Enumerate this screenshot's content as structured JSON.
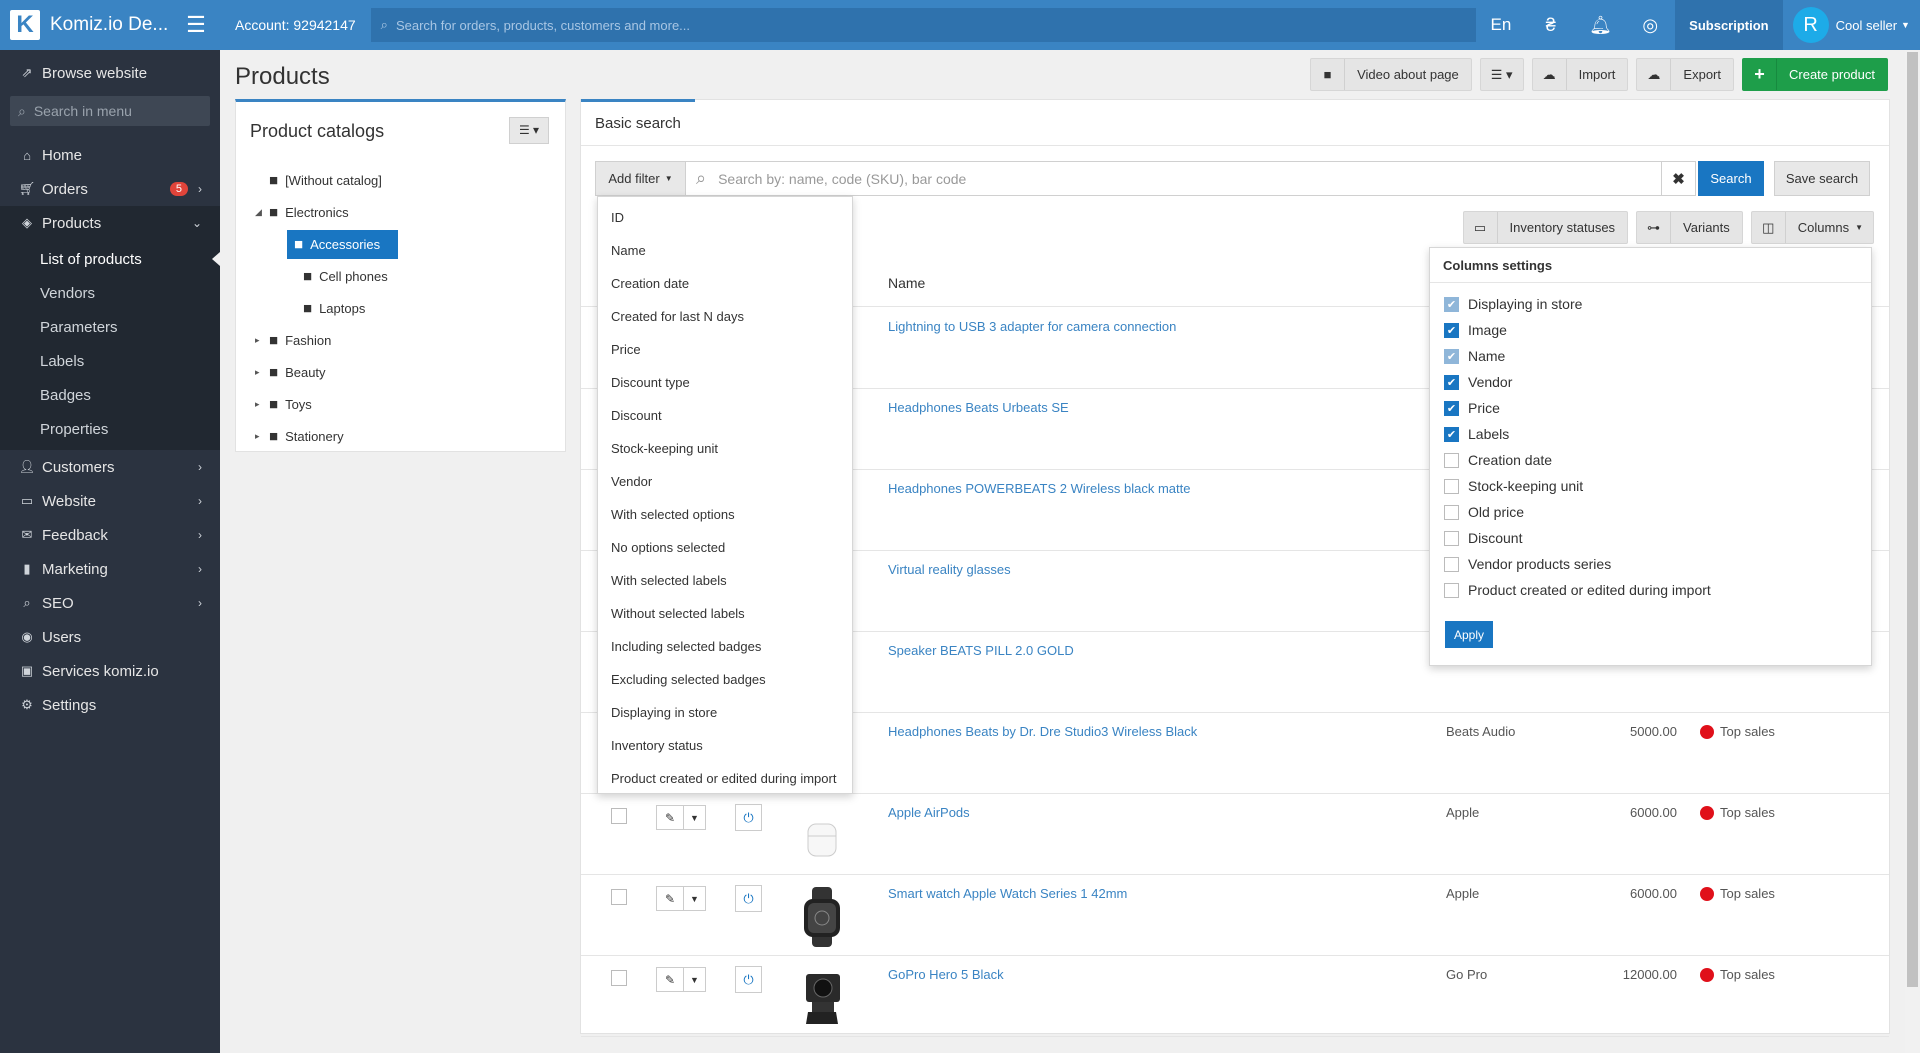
{
  "app": {
    "logo_letter": "K",
    "name": "Komiz.io De..."
  },
  "topbar": {
    "account": "Account: 92942147",
    "search_placeholder": "Search for orders, products, customers and more...",
    "lang": "En",
    "currency_icon": "₴",
    "subscription": "Subscription",
    "user_initial": "R",
    "user_name": "Cool seller"
  },
  "sidebar": {
    "browse": "Browse website",
    "search_placeholder": "Search in menu",
    "home": "Home",
    "orders": "Orders",
    "orders_badge": "5",
    "products": "Products",
    "products_sub": [
      "List of products",
      "Vendors",
      "Parameters",
      "Labels",
      "Badges",
      "Properties"
    ],
    "customers": "Customers",
    "website": "Website",
    "feedback": "Feedback",
    "marketing": "Marketing",
    "seo": "SEO",
    "users": "Users",
    "services": "Services komiz.io",
    "settings": "Settings"
  },
  "page": {
    "title": "Products",
    "video_btn": "Video about page",
    "import_btn": "Import",
    "export_btn": "Export",
    "create_btn": "Create product"
  },
  "catalogs": {
    "title": "Product catalogs",
    "items": [
      "[Without catalog]",
      "Electronics",
      "Accessories",
      "Cell phones",
      "Laptops",
      "Fashion",
      "Beauty",
      "Toys",
      "Stationery"
    ]
  },
  "search": {
    "tab": "Basic search",
    "add_filter": "Add filter",
    "placeholder": "Search by: name, code (SKU), bar code",
    "search_btn": "Search",
    "save_btn": "Save search"
  },
  "view_buttons": {
    "inventory": "Inventory statuses",
    "variants": "Variants",
    "columns": "Columns"
  },
  "table": {
    "name_header": "Name",
    "rows": [
      {
        "name": "Lightning to USB 3 adapter for camera connection",
        "vendor": "",
        "price": "",
        "label": ""
      },
      {
        "name": "Headphones Beats Urbeats SE",
        "vendor": "",
        "price": "",
        "label": ""
      },
      {
        "name": "Headphones POWERBEATS 2 Wireless black matte",
        "vendor": "",
        "price": "",
        "label": ""
      },
      {
        "name": "Virtual reality glasses",
        "vendor": "",
        "price": "",
        "label": ""
      },
      {
        "name": "Speaker BEATS PILL 2.0 GOLD",
        "vendor": "",
        "price": "",
        "label": ""
      },
      {
        "name": "Headphones Beats by Dr. Dre Studio3 Wireless Black",
        "vendor": "Beats Audio",
        "price": "5000.00",
        "label": "Top sales"
      },
      {
        "name": "Apple AirPods",
        "vendor": "Apple",
        "price": "6000.00",
        "label": "Top sales"
      },
      {
        "name": "Smart watch Apple Watch Series 1 42mm",
        "vendor": "Apple",
        "price": "6000.00",
        "label": "Top sales"
      },
      {
        "name": "GoPro Hero 5 Black",
        "vendor": "Go Pro",
        "price": "12000.00",
        "label": "Top sales"
      }
    ]
  },
  "filter_dropdown": [
    "ID",
    "Name",
    "Creation date",
    "Created for last N days",
    "Price",
    "Discount type",
    "Discount",
    "Stock-keeping unit",
    "Vendor",
    "With selected options",
    "No options selected",
    "With selected labels",
    "Without selected labels",
    "Including selected badges",
    "Excluding selected badges",
    "Displaying in store",
    "Inventory status",
    "Product created or edited during import"
  ],
  "columns_settings": {
    "title": "Columns settings",
    "apply": "Apply",
    "items": [
      {
        "label": "Displaying in store",
        "checked": true,
        "disabled": true
      },
      {
        "label": "Image",
        "checked": true,
        "disabled": false
      },
      {
        "label": "Name",
        "checked": true,
        "disabled": true
      },
      {
        "label": "Vendor",
        "checked": true,
        "disabled": false
      },
      {
        "label": "Price",
        "checked": true,
        "disabled": false
      },
      {
        "label": "Labels",
        "checked": true,
        "disabled": false
      },
      {
        "label": "Creation date",
        "checked": false,
        "disabled": false
      },
      {
        "label": "Stock-keeping unit",
        "checked": false,
        "disabled": false
      },
      {
        "label": "Old price",
        "checked": false,
        "disabled": false
      },
      {
        "label": "Discount",
        "checked": false,
        "disabled": false
      },
      {
        "label": "Vendor products series",
        "checked": false,
        "disabled": false
      },
      {
        "label": "Product created or edited during import",
        "checked": false,
        "disabled": false
      }
    ]
  },
  "colors": {
    "accent": "#3a84c3",
    "sidebar": "#2b3340",
    "green": "#1e9e4a",
    "label_red": "#e0101a"
  }
}
